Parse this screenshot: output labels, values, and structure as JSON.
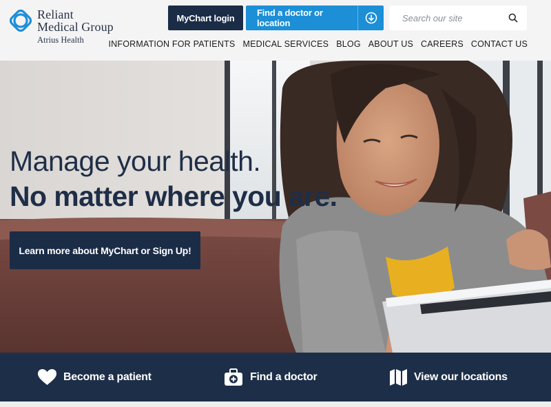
{
  "brand": {
    "line1": "Reliant",
    "line2": "Medical Group",
    "line3": "Atrius Health",
    "color_primary": "#1c8fd6",
    "color_navy": "#1b2c47"
  },
  "header": {
    "mychart_label": "MyChart login",
    "find_label": "Find a doctor or location",
    "find_icon": "circle-arrow-down-icon",
    "search_placeholder": "Search our site",
    "search_icon": "search-icon"
  },
  "nav": {
    "items": [
      {
        "label": "INFORMATION FOR PATIENTS"
      },
      {
        "label": "MEDICAL SERVICES"
      },
      {
        "label": "BLOG"
      },
      {
        "label": "ABOUT US"
      },
      {
        "label": "CAREERS"
      },
      {
        "label": "CONTACT US"
      }
    ]
  },
  "hero": {
    "headline": "Manage your health.",
    "subheadline": "No matter where you are.",
    "cta_label": "Learn more about MyChart or Sign Up!"
  },
  "bottom_bar": {
    "items": [
      {
        "label": "Become a patient",
        "icon": "heart-icon"
      },
      {
        "label": "Find a doctor",
        "icon": "medical-kit-icon"
      },
      {
        "label": "View our locations",
        "icon": "map-icon"
      }
    ]
  }
}
